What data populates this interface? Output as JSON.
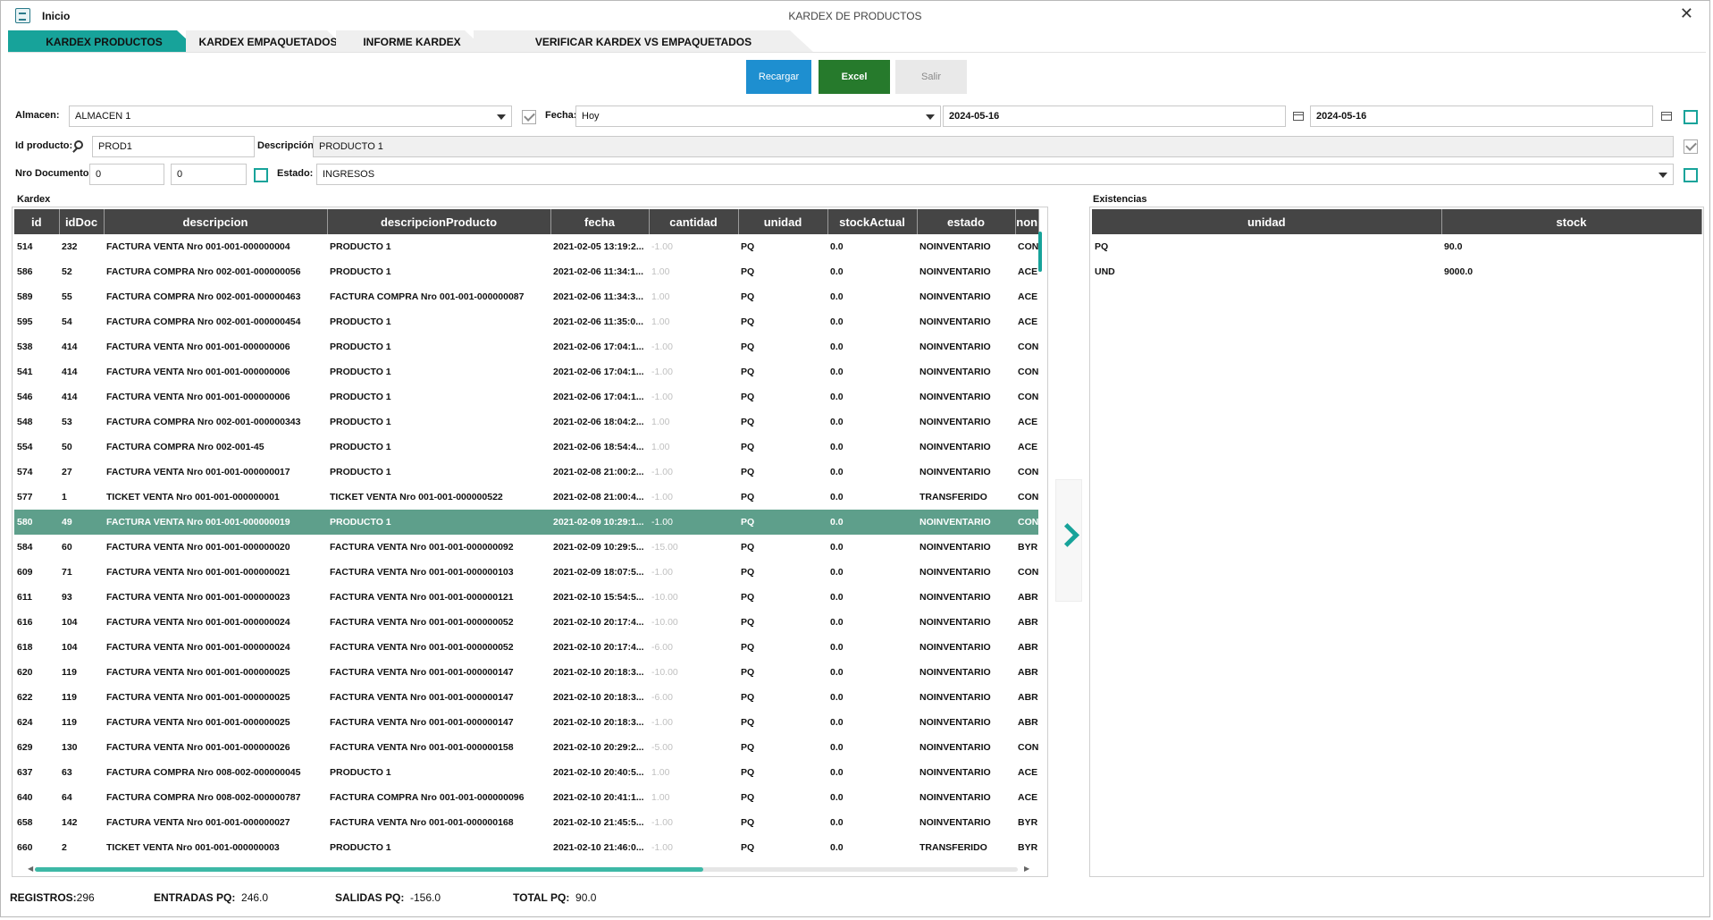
{
  "window": {
    "app_label": "Inicio",
    "title": "KARDEX DE PRODUCTOS",
    "close": "✕"
  },
  "tabs": [
    "KARDEX PRODUCTOS",
    "KARDEX EMPAQUETADOS",
    "INFORME KARDEX",
    "VERIFICAR KARDEX VS EMPAQUETADOS"
  ],
  "buttons": {
    "recargar": "Recargar",
    "excel": "Excel",
    "salir": "Salir"
  },
  "filters": {
    "almacen_label": "Almacen:",
    "almacen_value": "ALMACEN 1",
    "fecha_label": "Fecha:",
    "fecha_value": "Hoy",
    "date_from": "2024-05-16",
    "date_to": "2024-05-16",
    "idproducto_label": "Id producto:",
    "idproducto_value": "PROD1",
    "descripcion_label": "Descripción:",
    "descripcion_value": "PRODUCTO 1",
    "nrodoc_label": "Nro Documento:",
    "nrodoc_from": "0",
    "nrodoc_to": "0",
    "estado_label": "Estado:",
    "estado_value": "INGRESOS"
  },
  "kardex": {
    "label": "Kardex",
    "columns": [
      "id",
      "idDoc",
      "descripcion",
      "descripcionProducto",
      "fecha",
      "cantidad",
      "unidad",
      "stockActual",
      "estado",
      "non"
    ],
    "selected_row": 11,
    "rows": [
      [
        "514",
        "232",
        "FACTURA VENTA Nro 001-001-000000004",
        "PRODUCTO 1",
        "2021-02-05 13:19:2...",
        "-1.00",
        "PQ",
        "0.0",
        "NOINVENTARIO",
        "CON"
      ],
      [
        "586",
        "52",
        "FACTURA COMPRA Nro 002-001-000000056",
        "PRODUCTO 1",
        "2021-02-06 11:34:1...",
        "1.00",
        "PQ",
        "0.0",
        "NOINVENTARIO",
        "ACE"
      ],
      [
        "589",
        "55",
        "FACTURA COMPRA Nro 002-001-000000463",
        "FACTURA COMPRA Nro 001-001-000000087",
        "2021-02-06 11:34:3...",
        "1.00",
        "PQ",
        "0.0",
        "NOINVENTARIO",
        "ACE"
      ],
      [
        "595",
        "54",
        "FACTURA COMPRA Nro 002-001-000000454",
        "PRODUCTO 1",
        "2021-02-06 11:35:0...",
        "1.00",
        "PQ",
        "0.0",
        "NOINVENTARIO",
        "ACE"
      ],
      [
        "538",
        "414",
        "FACTURA VENTA Nro 001-001-000000006",
        "PRODUCTO 1",
        "2021-02-06 17:04:1...",
        "-1.00",
        "PQ",
        "0.0",
        "NOINVENTARIO",
        "CON"
      ],
      [
        "541",
        "414",
        "FACTURA VENTA Nro 001-001-000000006",
        "PRODUCTO 1",
        "2021-02-06 17:04:1...",
        "-1.00",
        "PQ",
        "0.0",
        "NOINVENTARIO",
        "CON"
      ],
      [
        "546",
        "414",
        "FACTURA VENTA Nro 001-001-000000006",
        "PRODUCTO 1",
        "2021-02-06 17:04:1...",
        "-1.00",
        "PQ",
        "0.0",
        "NOINVENTARIO",
        "CON"
      ],
      [
        "548",
        "53",
        "FACTURA COMPRA Nro 002-001-000000343",
        "PRODUCTO 1",
        "2021-02-06 18:04:2...",
        "1.00",
        "PQ",
        "0.0",
        "NOINVENTARIO",
        "ACE"
      ],
      [
        "554",
        "50",
        "FACTURA COMPRA Nro 002-001-45",
        "PRODUCTO 1",
        "2021-02-06 18:54:4...",
        "1.00",
        "PQ",
        "0.0",
        "NOINVENTARIO",
        "ACE"
      ],
      [
        "574",
        "27",
        "FACTURA VENTA Nro 001-001-000000017",
        "PRODUCTO 1",
        "2021-02-08 21:00:2...",
        "-1.00",
        "PQ",
        "0.0",
        "NOINVENTARIO",
        "CON"
      ],
      [
        "577",
        "1",
        "TICKET VENTA Nro 001-001-000000001",
        "TICKET VENTA Nro 001-001-000000522",
        "2021-02-08 21:00:4...",
        "-1.00",
        "PQ",
        "0.0",
        "TRANSFERIDO",
        "CON"
      ],
      [
        "580",
        "49",
        "FACTURA VENTA Nro 001-001-000000019",
        "PRODUCTO 1",
        "2021-02-09 10:29:1...",
        "-1.00",
        "PQ",
        "0.0",
        "NOINVENTARIO",
        "CON"
      ],
      [
        "584",
        "60",
        "FACTURA VENTA Nro 001-001-000000020",
        "FACTURA VENTA Nro 001-001-000000092",
        "2021-02-09 10:29:5...",
        "-15.00",
        "PQ",
        "0.0",
        "NOINVENTARIO",
        "BYR"
      ],
      [
        "609",
        "71",
        "FACTURA VENTA Nro 001-001-000000021",
        "FACTURA VENTA Nro 001-001-000000103",
        "2021-02-09 18:07:5...",
        "-1.00",
        "PQ",
        "0.0",
        "NOINVENTARIO",
        "CON"
      ],
      [
        "611",
        "93",
        "FACTURA VENTA Nro 001-001-000000023",
        "FACTURA VENTA Nro 001-001-000000121",
        "2021-02-10 15:54:5...",
        "-10.00",
        "PQ",
        "0.0",
        "NOINVENTARIO",
        "ABR"
      ],
      [
        "616",
        "104",
        "FACTURA VENTA Nro 001-001-000000024",
        "FACTURA VENTA Nro 001-001-000000052",
        "2021-02-10 20:17:4...",
        "-10.00",
        "PQ",
        "0.0",
        "NOINVENTARIO",
        "ABR"
      ],
      [
        "618",
        "104",
        "FACTURA VENTA Nro 001-001-000000024",
        "FACTURA VENTA Nro 001-001-000000052",
        "2021-02-10 20:17:4...",
        "-6.00",
        "PQ",
        "0.0",
        "NOINVENTARIO",
        "ABR"
      ],
      [
        "620",
        "119",
        "FACTURA VENTA Nro 001-001-000000025",
        "FACTURA VENTA Nro 001-001-000000147",
        "2021-02-10 20:18:3...",
        "-10.00",
        "PQ",
        "0.0",
        "NOINVENTARIO",
        "ABR"
      ],
      [
        "622",
        "119",
        "FACTURA VENTA Nro 001-001-000000025",
        "FACTURA VENTA Nro 001-001-000000147",
        "2021-02-10 20:18:3...",
        "-6.00",
        "PQ",
        "0.0",
        "NOINVENTARIO",
        "ABR"
      ],
      [
        "624",
        "119",
        "FACTURA VENTA Nro 001-001-000000025",
        "FACTURA VENTA Nro 001-001-000000147",
        "2021-02-10 20:18:3...",
        "-1.00",
        "PQ",
        "0.0",
        "NOINVENTARIO",
        "ABR"
      ],
      [
        "629",
        "130",
        "FACTURA VENTA Nro 001-001-000000026",
        "FACTURA VENTA Nro 001-001-000000158",
        "2021-02-10 20:29:2...",
        "-5.00",
        "PQ",
        "0.0",
        "NOINVENTARIO",
        "CON"
      ],
      [
        "637",
        "63",
        "FACTURA COMPRA Nro 008-002-000000045",
        "PRODUCTO 1",
        "2021-02-10 20:40:5...",
        "1.00",
        "PQ",
        "0.0",
        "NOINVENTARIO",
        "ACE"
      ],
      [
        "640",
        "64",
        "FACTURA COMPRA Nro 008-002-000000787",
        "FACTURA COMPRA Nro 001-001-000000096",
        "2021-02-10 20:41:1...",
        "1.00",
        "PQ",
        "0.0",
        "NOINVENTARIO",
        "ACE"
      ],
      [
        "658",
        "142",
        "FACTURA VENTA Nro 001-001-000000027",
        "FACTURA VENTA Nro 001-001-000000168",
        "2021-02-10 21:45:5...",
        "-1.00",
        "PQ",
        "0.0",
        "NOINVENTARIO",
        "BYR"
      ],
      [
        "660",
        "2",
        "TICKET VENTA Nro 001-001-000000003",
        "PRODUCTO 1",
        "2021-02-10 21:46:0...",
        "-1.00",
        "PQ",
        "0.0",
        "TRANSFERIDO",
        "BYR"
      ]
    ]
  },
  "existencias": {
    "label": "Existencias",
    "columns": [
      "unidad",
      "stock"
    ],
    "rows": [
      [
        "PQ",
        "90.0"
      ],
      [
        "UND",
        "9000.0"
      ]
    ]
  },
  "footer": {
    "registros_label": "REGISTROS:",
    "registros_value": "296",
    "entradas_label": "ENTRADAS PQ:",
    "entradas_value": "246.0",
    "salidas_label": "SALIDAS PQ:",
    "salidas_value": "-156.0",
    "total_label": "TOTAL PQ:",
    "total_value": "90.0"
  },
  "colors": {
    "accent": "#17a39a",
    "selected_row": "#5e9f8b",
    "header_bg": "#454545",
    "btn_blue": "#1e8fd0",
    "btn_green": "#267a2c"
  }
}
